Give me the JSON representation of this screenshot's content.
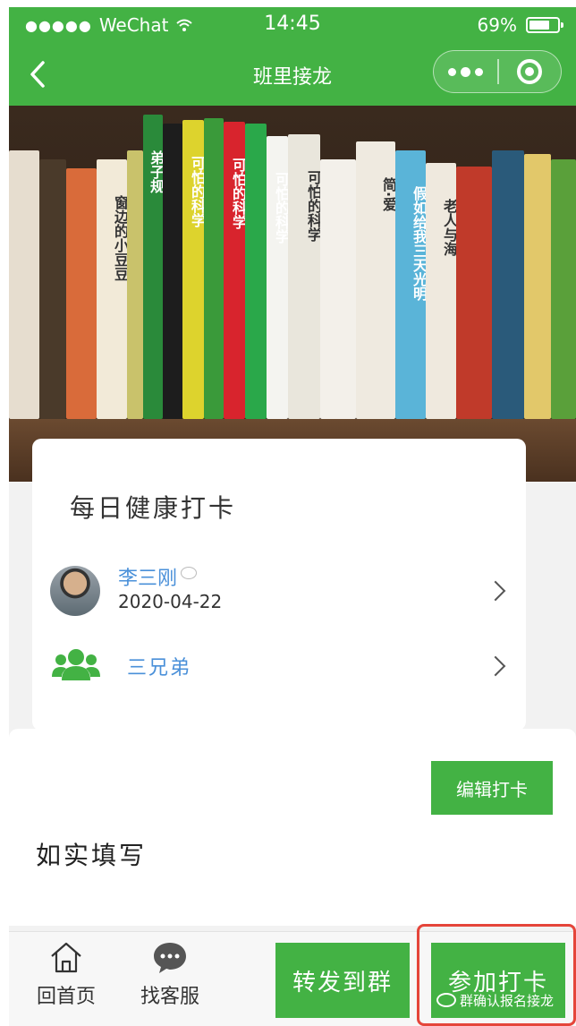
{
  "status_bar": {
    "carrier": "WeChat",
    "time": "14:45",
    "battery": "69%"
  },
  "nav": {
    "title": "班里接龙"
  },
  "card": {
    "title": "每日健康打卡",
    "author": {
      "name": "李三刚",
      "date": "2020-04-22"
    },
    "group": {
      "name": "三兄弟"
    }
  },
  "content": {
    "edit_label": "编辑打卡",
    "text": "如实填写"
  },
  "bottom_bar": {
    "home_label": "回首页",
    "service_label": "找客服",
    "share_label": "转发到群",
    "join_label": "参加打卡"
  },
  "watermark": {
    "text": "群确认报名接龙"
  },
  "banner": {
    "book_titles": [
      "窗边的小豆豆",
      "弟子规",
      "可怕的科学",
      "可怕的科学",
      "可怕的科学",
      "可怕的科学",
      "简·爱",
      "假如给我三天光明",
      "老人与海"
    ]
  },
  "colors": {
    "brand_green": "#43b244",
    "link_blue": "#4a90d9",
    "highlight_red": "#e5453a"
  }
}
